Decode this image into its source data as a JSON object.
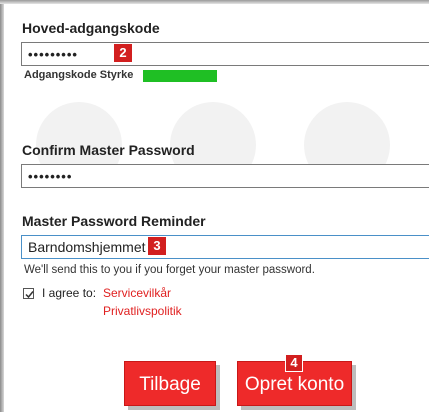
{
  "master_password": {
    "label": "Hoved-adgangskode",
    "value": "•••••••••",
    "badge": "2",
    "strength_label": "Adgangskode Styrke",
    "strength_fraction": 1.0,
    "strength_color": "#1fbf24"
  },
  "confirm_password": {
    "label": "Confirm Master Password",
    "value": "••••••••"
  },
  "reminder": {
    "label": "Master Password Reminder",
    "value": "Barndomshjemmet",
    "badge": "3",
    "hint": "We'll send this to you if you forget your master password."
  },
  "agreement": {
    "checked": true,
    "label": "I agree to:",
    "links": [
      "Servicevilkår",
      "Privatlivspolitik"
    ]
  },
  "buttons": {
    "back_label": "Tilbage",
    "create_label": "Opret konto",
    "create_badge": "4"
  },
  "colors": {
    "accent": "#ee2a2a",
    "badge": "#d21f1f",
    "link": "#e02020"
  }
}
